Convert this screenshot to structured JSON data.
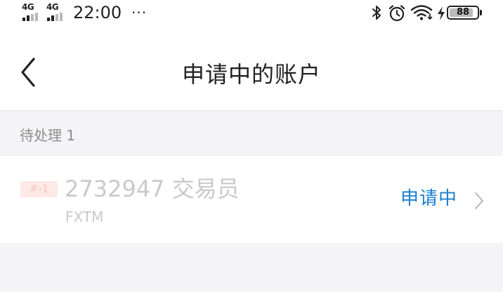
{
  "status_bar": {
    "signal_1_label": "4G",
    "signal_2_label": "4G",
    "time": "22:00",
    "more": "···",
    "icons": [
      "bluetooth-icon",
      "alarm-icon",
      "wifi-icon",
      "charging-icon"
    ],
    "battery_level": "88",
    "battery_fraction": 0.88
  },
  "nav": {
    "back_icon": "chevron-left-icon",
    "title": "申请中的账户"
  },
  "section": {
    "label": "待处理 1"
  },
  "accounts": [
    {
      "tag": "#-1",
      "title": "2732947 交易员",
      "broker": "FXTM",
      "status": "申请中",
      "chevron_icon": "chevron-right-icon"
    }
  ],
  "colors": {
    "accent": "#1a7fd1",
    "background": "#f4f4f6",
    "tag_bg": "#fde9e6",
    "tag_text": "#f6c7bd",
    "muted_text": "#c9c9c9"
  }
}
